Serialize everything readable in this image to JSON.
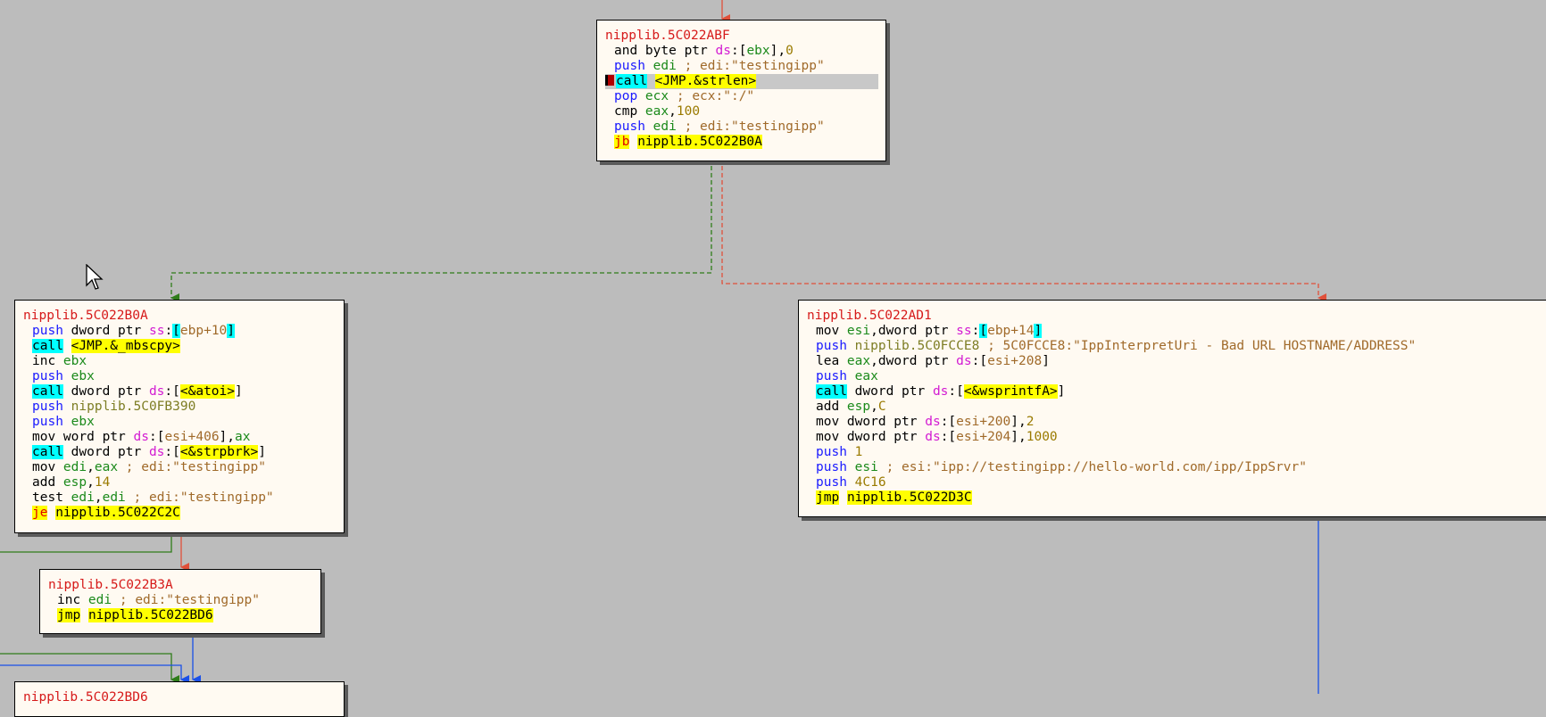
{
  "blocks": [
    {
      "id": "5C022ABF",
      "label": "nipplib.5C022ABF",
      "lines": [
        {
          "tokens": [
            {
              "t": "and byte ptr ",
              "c": "txt"
            },
            {
              "t": "ds",
              "c": "seg"
            },
            {
              "t": ":[",
              "c": "txt"
            },
            {
              "t": "ebx",
              "c": "reg"
            },
            {
              "t": "],",
              "c": "txt"
            },
            {
              "t": "0",
              "c": "num"
            }
          ]
        },
        {
          "tokens": [
            {
              "t": "push ",
              "c": "kw"
            },
            {
              "t": "edi",
              "c": "reg"
            },
            {
              "t": " ; edi:\"testingipp\"",
              "c": "com"
            }
          ]
        },
        {
          "current": true,
          "breakpoint": true,
          "tokens": [
            {
              "t": "call",
              "c": "call"
            },
            {
              "t": " ",
              "c": "txt"
            },
            {
              "t": "<JMP.&strlen>",
              "c": "hl"
            }
          ]
        },
        {
          "tokens": [
            {
              "t": "pop ",
              "c": "kw"
            },
            {
              "t": "ecx",
              "c": "reg"
            },
            {
              "t": " ; ecx:\":/\"",
              "c": "com"
            }
          ]
        },
        {
          "tokens": [
            {
              "t": "cmp ",
              "c": "txt"
            },
            {
              "t": "eax",
              "c": "reg"
            },
            {
              "t": ",",
              "c": "txt"
            },
            {
              "t": "100",
              "c": "num"
            }
          ]
        },
        {
          "tokens": [
            {
              "t": "push ",
              "c": "kw"
            },
            {
              "t": "edi",
              "c": "reg"
            },
            {
              "t": " ; edi:\"testingipp\"",
              "c": "com"
            }
          ]
        },
        {
          "tokens": [
            {
              "t": "jb",
              "c": "jcc"
            },
            {
              "t": " ",
              "c": "txt"
            },
            {
              "t": "nipplib.5C022B0A",
              "c": "hl"
            }
          ]
        }
      ]
    },
    {
      "id": "5C022B0A",
      "label": "nipplib.5C022B0A",
      "lines": [
        {
          "tokens": [
            {
              "t": "push ",
              "c": "kw"
            },
            {
              "t": "dword ptr ",
              "c": "txt"
            },
            {
              "t": "ss",
              "c": "seg"
            },
            {
              "t": ":",
              "c": "txt"
            },
            {
              "t": "[",
              "c": "hlbr"
            },
            {
              "t": "ebp+10",
              "c": "com"
            },
            {
              "t": "]",
              "c": "hlbr"
            }
          ]
        },
        {
          "tokens": [
            {
              "t": "call",
              "c": "call"
            },
            {
              "t": " ",
              "c": "txt"
            },
            {
              "t": "<JMP.&_mbscpy>",
              "c": "hl"
            }
          ]
        },
        {
          "tokens": [
            {
              "t": "inc ",
              "c": "txt"
            },
            {
              "t": "ebx",
              "c": "reg"
            }
          ]
        },
        {
          "tokens": [
            {
              "t": "push ",
              "c": "kw"
            },
            {
              "t": "ebx",
              "c": "reg"
            }
          ]
        },
        {
          "tokens": [
            {
              "t": "call",
              "c": "call"
            },
            {
              "t": " dword ptr ",
              "c": "txt"
            },
            {
              "t": "ds",
              "c": "seg"
            },
            {
              "t": ":[",
              "c": "txt"
            },
            {
              "t": "<&atoi>",
              "c": "hl"
            },
            {
              "t": "]",
              "c": "txt"
            }
          ]
        },
        {
          "tokens": [
            {
              "t": "push ",
              "c": "kw"
            },
            {
              "t": "nipplib.5C0FB390",
              "c": "addr"
            }
          ]
        },
        {
          "tokens": [
            {
              "t": "push ",
              "c": "kw"
            },
            {
              "t": "ebx",
              "c": "reg"
            }
          ]
        },
        {
          "tokens": [
            {
              "t": "mov word ptr ",
              "c": "txt"
            },
            {
              "t": "ds",
              "c": "seg"
            },
            {
              "t": ":[",
              "c": "txt"
            },
            {
              "t": "esi+406",
              "c": "com"
            },
            {
              "t": "],",
              "c": "txt"
            },
            {
              "t": "ax",
              "c": "reg"
            }
          ]
        },
        {
          "tokens": [
            {
              "t": "call",
              "c": "call"
            },
            {
              "t": " dword ptr ",
              "c": "txt"
            },
            {
              "t": "ds",
              "c": "seg"
            },
            {
              "t": ":[",
              "c": "txt"
            },
            {
              "t": "<&strpbrk>",
              "c": "hl"
            },
            {
              "t": "]",
              "c": "txt"
            }
          ]
        },
        {
          "tokens": [
            {
              "t": "mov ",
              "c": "txt"
            },
            {
              "t": "edi",
              "c": "reg"
            },
            {
              "t": ",",
              "c": "txt"
            },
            {
              "t": "eax",
              "c": "reg"
            },
            {
              "t": " ; edi:\"testingipp\"",
              "c": "com"
            }
          ]
        },
        {
          "tokens": [
            {
              "t": "add ",
              "c": "txt"
            },
            {
              "t": "esp",
              "c": "reg"
            },
            {
              "t": ",",
              "c": "txt"
            },
            {
              "t": "14",
              "c": "num"
            }
          ]
        },
        {
          "tokens": [
            {
              "t": "test ",
              "c": "txt"
            },
            {
              "t": "edi",
              "c": "reg"
            },
            {
              "t": ",",
              "c": "txt"
            },
            {
              "t": "edi",
              "c": "reg"
            },
            {
              "t": " ; edi:\"testingipp\"",
              "c": "com"
            }
          ]
        },
        {
          "tokens": [
            {
              "t": "je",
              "c": "jcc"
            },
            {
              "t": " ",
              "c": "txt"
            },
            {
              "t": "nipplib.5C022C2C",
              "c": "hl"
            }
          ]
        }
      ]
    },
    {
      "id": "5C022AD1",
      "label": "nipplib.5C022AD1",
      "lines": [
        {
          "tokens": [
            {
              "t": "mov ",
              "c": "txt"
            },
            {
              "t": "esi",
              "c": "reg"
            },
            {
              "t": ",dword ptr ",
              "c": "txt"
            },
            {
              "t": "ss",
              "c": "seg"
            },
            {
              "t": ":",
              "c": "txt"
            },
            {
              "t": "[",
              "c": "hlbr"
            },
            {
              "t": "ebp+14",
              "c": "com"
            },
            {
              "t": "]",
              "c": "hlbr"
            }
          ]
        },
        {
          "tokens": [
            {
              "t": "push ",
              "c": "kw"
            },
            {
              "t": "nipplib.5C0FCCE8",
              "c": "addr"
            },
            {
              "t": " ; 5C0FCCE8:\"IppInterpretUri - Bad URL HOSTNAME/ADDRESS\"",
              "c": "com"
            }
          ]
        },
        {
          "tokens": [
            {
              "t": "lea ",
              "c": "txt"
            },
            {
              "t": "eax",
              "c": "reg"
            },
            {
              "t": ",dword ptr ",
              "c": "txt"
            },
            {
              "t": "ds",
              "c": "seg"
            },
            {
              "t": ":[",
              "c": "txt"
            },
            {
              "t": "esi+208",
              "c": "com"
            },
            {
              "t": "]",
              "c": "txt"
            }
          ]
        },
        {
          "tokens": [
            {
              "t": "push ",
              "c": "kw"
            },
            {
              "t": "eax",
              "c": "reg"
            }
          ]
        },
        {
          "tokens": [
            {
              "t": "call",
              "c": "call"
            },
            {
              "t": " dword ptr ",
              "c": "txt"
            },
            {
              "t": "ds",
              "c": "seg"
            },
            {
              "t": ":[",
              "c": "txt"
            },
            {
              "t": "<&wsprintfA>",
              "c": "hl"
            },
            {
              "t": "]",
              "c": "txt"
            }
          ]
        },
        {
          "tokens": [
            {
              "t": "add ",
              "c": "txt"
            },
            {
              "t": "esp",
              "c": "reg"
            },
            {
              "t": ",",
              "c": "txt"
            },
            {
              "t": "C",
              "c": "num"
            }
          ]
        },
        {
          "tokens": [
            {
              "t": "mov dword ptr ",
              "c": "txt"
            },
            {
              "t": "ds",
              "c": "seg"
            },
            {
              "t": ":[",
              "c": "txt"
            },
            {
              "t": "esi+200",
              "c": "com"
            },
            {
              "t": "],",
              "c": "txt"
            },
            {
              "t": "2",
              "c": "num"
            }
          ]
        },
        {
          "tokens": [
            {
              "t": "mov dword ptr ",
              "c": "txt"
            },
            {
              "t": "ds",
              "c": "seg"
            },
            {
              "t": ":[",
              "c": "txt"
            },
            {
              "t": "esi+204",
              "c": "com"
            },
            {
              "t": "],",
              "c": "txt"
            },
            {
              "t": "1000",
              "c": "num"
            }
          ]
        },
        {
          "tokens": [
            {
              "t": "push ",
              "c": "kw"
            },
            {
              "t": "1",
              "c": "num"
            }
          ]
        },
        {
          "tokens": [
            {
              "t": "push ",
              "c": "kw"
            },
            {
              "t": "esi",
              "c": "reg"
            },
            {
              "t": " ; esi:\"ipp://testingipp://hello-world.com/ipp/IppSrvr\"",
              "c": "com"
            }
          ]
        },
        {
          "tokens": [
            {
              "t": "push ",
              "c": "kw"
            },
            {
              "t": "4C16",
              "c": "num"
            }
          ]
        },
        {
          "tokens": [
            {
              "t": "jmp",
              "c": "jmp"
            },
            {
              "t": " ",
              "c": "txt"
            },
            {
              "t": "nipplib.5C022D3C",
              "c": "hl"
            }
          ]
        }
      ]
    },
    {
      "id": "5C022B3A",
      "label": "nipplib.5C022B3A",
      "lines": [
        {
          "tokens": [
            {
              "t": "inc ",
              "c": "txt"
            },
            {
              "t": "edi",
              "c": "reg"
            },
            {
              "t": " ; edi:\"testingipp\"",
              "c": "com"
            }
          ]
        },
        {
          "tokens": [
            {
              "t": "jmp",
              "c": "jmp"
            },
            {
              "t": " ",
              "c": "txt"
            },
            {
              "t": "nipplib.5C022BD6",
              "c": "hl"
            }
          ]
        }
      ]
    },
    {
      "id": "5C022BD6",
      "label": "nipplib.5C022BD6",
      "lines": []
    }
  ],
  "colors": {
    "background": "#bcbcbc",
    "edge_false": "#e0503a",
    "edge_true": "#2f7d1a",
    "edge_uncond": "#1a50e8"
  }
}
